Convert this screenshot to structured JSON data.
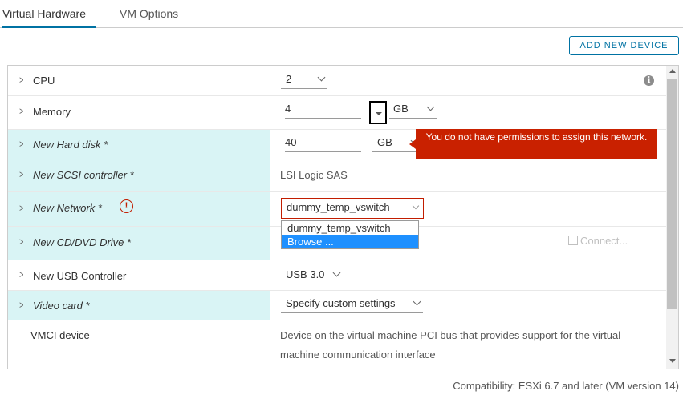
{
  "tabs": [
    {
      "label": "Virtual Hardware",
      "active": true
    },
    {
      "label": "VM Options",
      "active": false
    }
  ],
  "toolbar": {
    "add_device_label": "ADD NEW DEVICE"
  },
  "rows": {
    "cpu": {
      "label": "CPU",
      "value": "2"
    },
    "memory": {
      "label": "Memory",
      "value": "4",
      "unit": "GB"
    },
    "hard_disk": {
      "label": "New Hard disk *",
      "value": "40",
      "unit": "GB"
    },
    "scsi": {
      "label": "New SCSI controller *",
      "value": "LSI Logic SAS"
    },
    "network": {
      "label": "New Network *",
      "value": "dummy_temp_vswitch",
      "error": "You do not have permissions to assign this network.",
      "options": [
        "dummy_temp_vswitch",
        "Browse ..."
      ],
      "highlighted_option": "Browse ..."
    },
    "cdrom": {
      "label": "New CD/DVD Drive *",
      "connect_label": "Connect..."
    },
    "usb": {
      "label": "New USB Controller",
      "value": "USB 3.0"
    },
    "video": {
      "label": "Video card *",
      "value": "Specify custom settings"
    },
    "vmci": {
      "label": "VMCI device",
      "description_line1": "Device on the virtual machine PCI bus that provides support for the virtual",
      "description_line2": "machine communication interface"
    }
  },
  "footer": {
    "compatibility": "Compatibility: ESXi 6.7 and later (VM version 14)"
  },
  "icons": {
    "expand": "chevron-right-icon",
    "info": "info-icon",
    "warning": "error-icon"
  },
  "colors": {
    "accent": "#0072a3",
    "error": "#c92100",
    "new_row_bg": "#d9f4f5",
    "selected_option": "#1e90ff"
  }
}
